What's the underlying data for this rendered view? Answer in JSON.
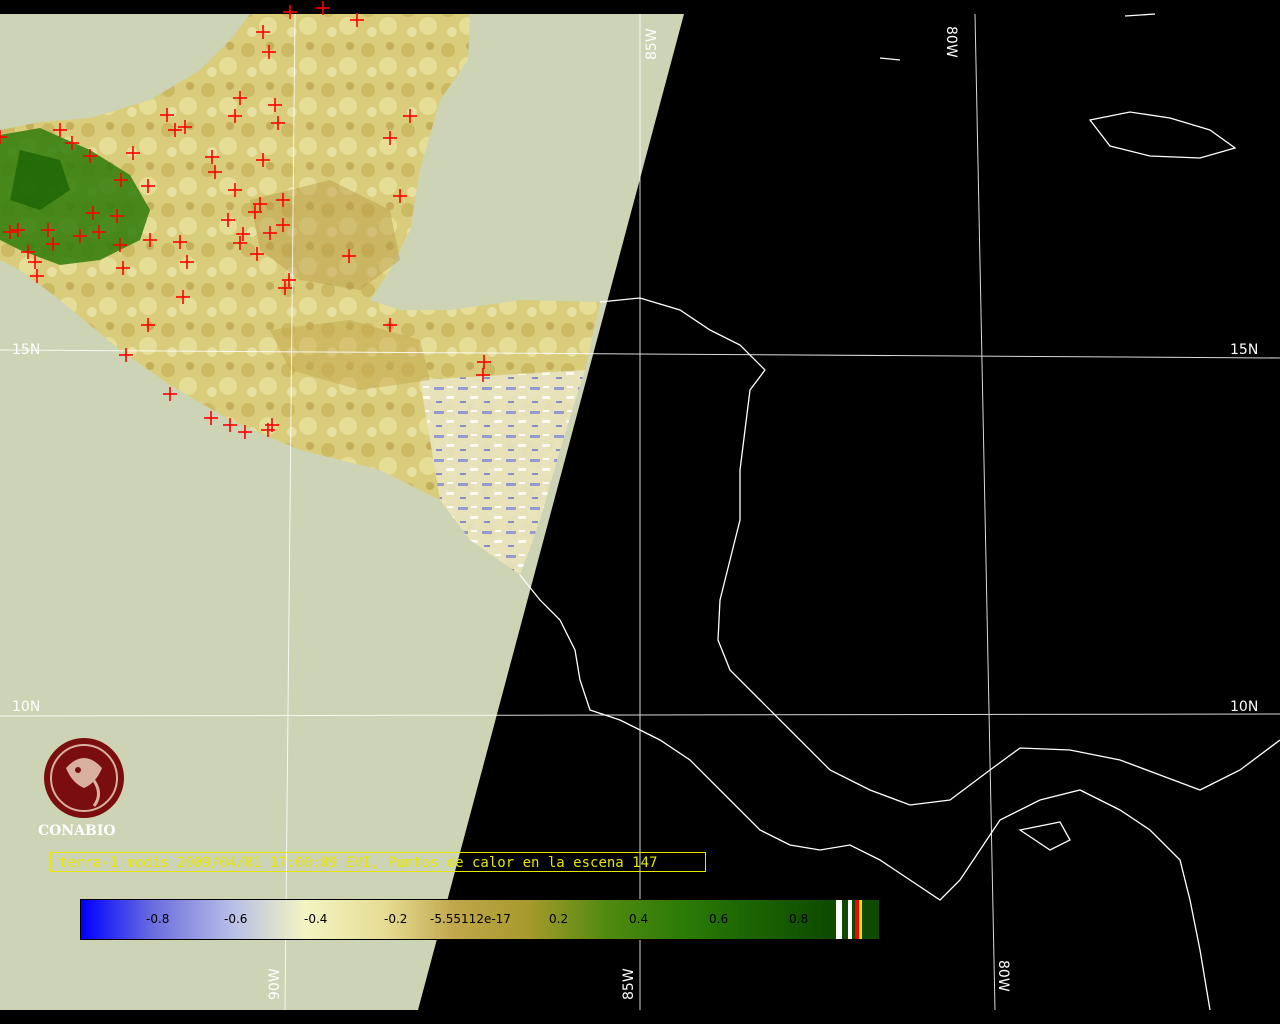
{
  "map": {
    "land_region": "Central America",
    "gridlines": {
      "lat_labels": [
        "15N",
        "10N"
      ],
      "lon_labels": [
        "85W",
        "90W",
        "80W"
      ]
    }
  },
  "logo": {
    "name": "CONABIO"
  },
  "caption": "terra-1 modis 2009/04/01 17:00:09 EVI, Puntos de calor en la escena 147",
  "colorbar": {
    "ticks": [
      "-0.8",
      "-0.6",
      "-0.4",
      "-0.2",
      "-5.55112e-17",
      "0.2",
      "0.4",
      "0.6",
      "0.8"
    ],
    "colors": {
      "low": "#0000ff",
      "mid": "#f2f4c2",
      "high": "#0e4a00"
    }
  },
  "hotspots": {
    "count_label": "147",
    "marker_color": "#ff0000"
  },
  "colors": {
    "nodata": "#cdd4b5",
    "night": "#000000",
    "grid": "#ffffff",
    "caption": "#e6e600"
  }
}
